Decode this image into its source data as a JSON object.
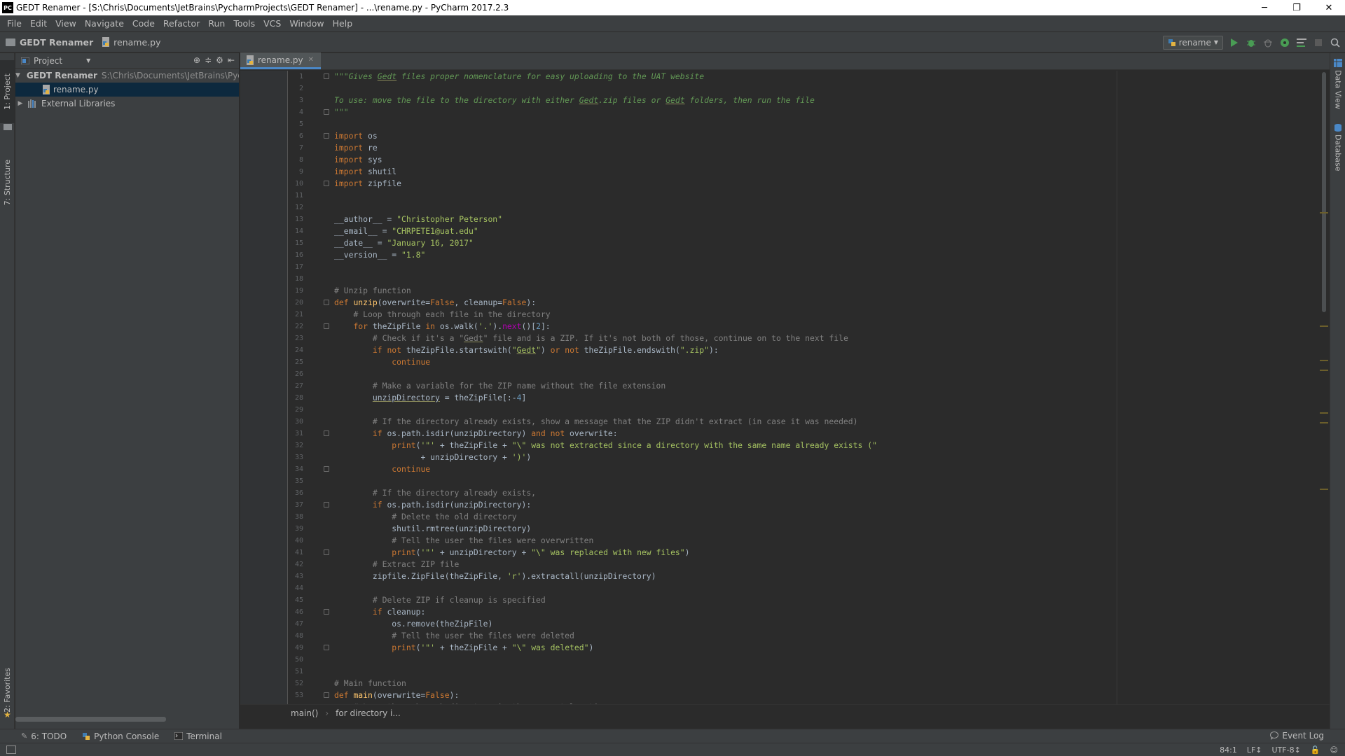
{
  "window": {
    "title": "GEDT Renamer - [S:\\Chris\\Documents\\JetBrains\\PycharmProjects\\GEDT Renamer] - ...\\rename.py - PyCharm 2017.2.3",
    "app_icon": "PC",
    "minimize": "─",
    "restore": "❐",
    "close": "✕"
  },
  "menu": [
    "File",
    "Edit",
    "View",
    "Navigate",
    "Code",
    "Refactor",
    "Run",
    "Tools",
    "VCS",
    "Window",
    "Help"
  ],
  "navbar": {
    "project": "GEDT Renamer",
    "file": "rename.py",
    "run_config": "rename"
  },
  "left_strip": {
    "project_tab": "1: Project",
    "structure_tab": "7: Structure",
    "favorites_tab": "2: Favorites"
  },
  "right_strip": {
    "data_view_tab": "Data View",
    "database_tab": "Database"
  },
  "project_panel": {
    "title": "Project",
    "tree": [
      {
        "label": "GEDT Renamer",
        "path": "S:\\Chris\\Documents\\JetBrains\\PycharmProjects\\GEDT Renamer",
        "expanded": true
      },
      {
        "label": "rename.py",
        "selected": true
      },
      {
        "label": "External Libraries",
        "expanded": false
      }
    ]
  },
  "editor": {
    "tab": "rename.py",
    "lines": [
      {
        "t": [
          [
            "doc",
            "\"\"\"Gives "
          ],
          [
            "doc un",
            "Gedt"
          ],
          [
            "doc",
            " files proper nomenclature for easy uploading to the UAT website"
          ]
        ],
        "fold": true
      },
      {
        "t": []
      },
      {
        "t": [
          [
            "doc",
            "To use: move the file to the directory with either "
          ],
          [
            "doc un",
            "Gedt"
          ],
          [
            "doc",
            ".zip files or "
          ],
          [
            "doc un",
            "Gedt"
          ],
          [
            "doc",
            " folders, then run the file"
          ]
        ]
      },
      {
        "t": [
          [
            "doc",
            "\"\"\""
          ]
        ],
        "fold": true
      },
      {
        "t": []
      },
      {
        "t": [
          [
            "kw",
            "import"
          ],
          [
            "pl",
            " os"
          ]
        ],
        "fold": true
      },
      {
        "t": [
          [
            "kw",
            "import"
          ],
          [
            "pl",
            " re"
          ]
        ]
      },
      {
        "t": [
          [
            "kw",
            "import"
          ],
          [
            "pl",
            " sys"
          ]
        ]
      },
      {
        "t": [
          [
            "kw",
            "import"
          ],
          [
            "pl",
            " shutil"
          ]
        ]
      },
      {
        "t": [
          [
            "kw",
            "import"
          ],
          [
            "pl",
            " zipfile"
          ]
        ],
        "fold": true
      },
      {
        "t": []
      },
      {
        "t": []
      },
      {
        "t": [
          [
            "pl",
            "__author__ = "
          ],
          [
            "str",
            "\"Christopher Peterson\""
          ]
        ]
      },
      {
        "t": [
          [
            "pl",
            "__email__ = "
          ],
          [
            "str",
            "\"CHRPETE1@uat.edu\""
          ]
        ]
      },
      {
        "t": [
          [
            "pl",
            "__date__ = "
          ],
          [
            "str",
            "\"January 16, 2017\""
          ]
        ]
      },
      {
        "t": [
          [
            "pl",
            "__version__ = "
          ],
          [
            "str",
            "\"1.8\""
          ]
        ]
      },
      {
        "t": []
      },
      {
        "t": []
      },
      {
        "t": [
          [
            "cm",
            "# Unzip function"
          ]
        ]
      },
      {
        "t": [
          [
            "kw",
            "def "
          ],
          [
            "fn",
            "unzip"
          ],
          [
            "pl",
            "(overwrite="
          ],
          [
            "kw",
            "False"
          ],
          [
            "pl",
            ", cleanup="
          ],
          [
            "kw",
            "False"
          ],
          [
            "pl",
            "):"
          ]
        ],
        "fold": true
      },
      {
        "t": [
          [
            "pl",
            "    "
          ],
          [
            "cm",
            "# Loop through each file in the directory"
          ]
        ]
      },
      {
        "t": [
          [
            "pl",
            "    "
          ],
          [
            "kw",
            "for"
          ],
          [
            "pl",
            " theZipFile "
          ],
          [
            "kw",
            "in"
          ],
          [
            "pl",
            " os.walk("
          ],
          [
            "str",
            "'.'"
          ],
          [
            "pl",
            ")."
          ],
          [
            "sp",
            "next"
          ],
          [
            "pl",
            "()["
          ],
          [
            "num",
            "2"
          ],
          [
            "pl",
            "]:"
          ]
        ],
        "fold": true
      },
      {
        "t": [
          [
            "pl",
            "        "
          ],
          [
            "cm",
            "# Check if it's a \""
          ],
          [
            "cm un",
            "Gedt"
          ],
          [
            "cm",
            "\" file and is a ZIP. If it's not both of those, continue on to the next file"
          ]
        ]
      },
      {
        "t": [
          [
            "pl",
            "        "
          ],
          [
            "kw",
            "if not"
          ],
          [
            "pl",
            " theZipFile.startswith("
          ],
          [
            "str",
            "\""
          ],
          [
            "str un",
            "Gedt"
          ],
          [
            "str",
            "\""
          ],
          [
            "pl",
            ") "
          ],
          [
            "kw",
            "or not"
          ],
          [
            "pl",
            " theZipFile.endswith("
          ],
          [
            "str",
            "\".zip\""
          ],
          [
            "pl",
            "):"
          ]
        ]
      },
      {
        "t": [
          [
            "pl",
            "            "
          ],
          [
            "kw",
            "continue"
          ]
        ]
      },
      {
        "t": []
      },
      {
        "t": [
          [
            "pl",
            "        "
          ],
          [
            "cm",
            "# Make a variable for the ZIP name without the file extension"
          ]
        ]
      },
      {
        "t": [
          [
            "pl",
            "        "
          ],
          [
            "pl un",
            "unzipDirectory"
          ],
          [
            "pl",
            " = theZipFile[:-"
          ],
          [
            "num",
            "4"
          ],
          [
            "pl",
            "]"
          ]
        ]
      },
      {
        "t": []
      },
      {
        "t": [
          [
            "pl",
            "        "
          ],
          [
            "cm",
            "# If the directory already exists, show a message that the ZIP didn't extract (in case it was needed)"
          ]
        ]
      },
      {
        "t": [
          [
            "pl",
            "        "
          ],
          [
            "kw",
            "if"
          ],
          [
            "pl",
            " os.path.isdir(unzipDirectory) "
          ],
          [
            "kw",
            "and not"
          ],
          [
            "pl",
            " overwrite:"
          ]
        ],
        "fold": true
      },
      {
        "t": [
          [
            "pl",
            "            "
          ],
          [
            "kw",
            "print"
          ],
          [
            "pl",
            "("
          ],
          [
            "str",
            "'\"' "
          ],
          [
            "pl",
            "+ theZipFile + "
          ],
          [
            "str",
            "\"\\\" was not extracted since a directory with the same name already exists (\""
          ]
        ]
      },
      {
        "t": [
          [
            "pl",
            "                  + unzipDirectory + "
          ],
          [
            "str",
            "')'"
          ],
          [
            "pl",
            ")"
          ]
        ]
      },
      {
        "t": [
          [
            "pl",
            "            "
          ],
          [
            "kw",
            "continue"
          ]
        ],
        "fold": true
      },
      {
        "t": []
      },
      {
        "t": [
          [
            "pl",
            "        "
          ],
          [
            "cm",
            "# If the directory already exists,"
          ]
        ]
      },
      {
        "t": [
          [
            "pl",
            "        "
          ],
          [
            "kw",
            "if"
          ],
          [
            "pl",
            " os.path.isdir(unzipDirectory):"
          ]
        ],
        "fold": true
      },
      {
        "t": [
          [
            "pl",
            "            "
          ],
          [
            "cm",
            "# Delete the old directory"
          ]
        ]
      },
      {
        "t": [
          [
            "pl",
            "            shutil.rmtree(unzipDirectory)"
          ]
        ]
      },
      {
        "t": [
          [
            "pl",
            "            "
          ],
          [
            "cm",
            "# Tell the user the files were overwritten"
          ]
        ]
      },
      {
        "t": [
          [
            "pl",
            "            "
          ],
          [
            "kw",
            "print"
          ],
          [
            "pl",
            "("
          ],
          [
            "str",
            "'\"' "
          ],
          [
            "pl",
            "+ unzipDirectory + "
          ],
          [
            "str",
            "\"\\\" was replaced with new files\""
          ],
          [
            "pl",
            ")"
          ]
        ],
        "fold": true
      },
      {
        "t": [
          [
            "pl",
            "        "
          ],
          [
            "cm",
            "# Extract ZIP file"
          ]
        ]
      },
      {
        "t": [
          [
            "pl",
            "        zipfile.ZipFile(theZipFile, "
          ],
          [
            "str",
            "'r'"
          ],
          [
            "pl",
            ").extractall(unzipDirectory)"
          ]
        ]
      },
      {
        "t": []
      },
      {
        "t": [
          [
            "pl",
            "        "
          ],
          [
            "cm",
            "# Delete ZIP if cleanup is specified"
          ]
        ]
      },
      {
        "t": [
          [
            "pl",
            "        "
          ],
          [
            "kw",
            "if"
          ],
          [
            "pl",
            " cleanup:"
          ]
        ],
        "fold": true
      },
      {
        "t": [
          [
            "pl",
            "            os.remove(theZipFile)"
          ]
        ]
      },
      {
        "t": [
          [
            "pl",
            "            "
          ],
          [
            "cm",
            "# Tell the user the files were deleted"
          ]
        ]
      },
      {
        "t": [
          [
            "pl",
            "            "
          ],
          [
            "kw",
            "print"
          ],
          [
            "pl",
            "("
          ],
          [
            "str",
            "'\"' "
          ],
          [
            "pl",
            "+ theZipFile + "
          ],
          [
            "str",
            "\"\\\" was deleted\""
          ],
          [
            "pl",
            ")"
          ]
        ],
        "fold": true
      },
      {
        "t": []
      },
      {
        "t": []
      },
      {
        "t": [
          [
            "cm",
            "# Main function"
          ]
        ]
      },
      {
        "t": [
          [
            "kw",
            "def "
          ],
          [
            "fn",
            "main"
          ],
          [
            "pl",
            "(overwrite="
          ],
          [
            "kw",
            "False"
          ],
          [
            "pl",
            "):"
          ]
        ],
        "fold": true
      },
      {
        "t": [
          [
            "pl",
            "    "
          ],
          [
            "cm",
            "# Loop through each directory in the current location"
          ]
        ]
      }
    ],
    "breadcrumbs": [
      "main()",
      "for directory i..."
    ]
  },
  "bottom_tabs": [
    "6: TODO",
    "Python Console",
    "Terminal"
  ],
  "event_log": "Event Log",
  "status": {
    "position": "84:1",
    "line_sep": "LF↕",
    "encoding": "UTF-8↕"
  },
  "colors": {
    "run_green": "#499c54",
    "selection": "#0d293e",
    "tab_underline": "#4a88c7"
  }
}
